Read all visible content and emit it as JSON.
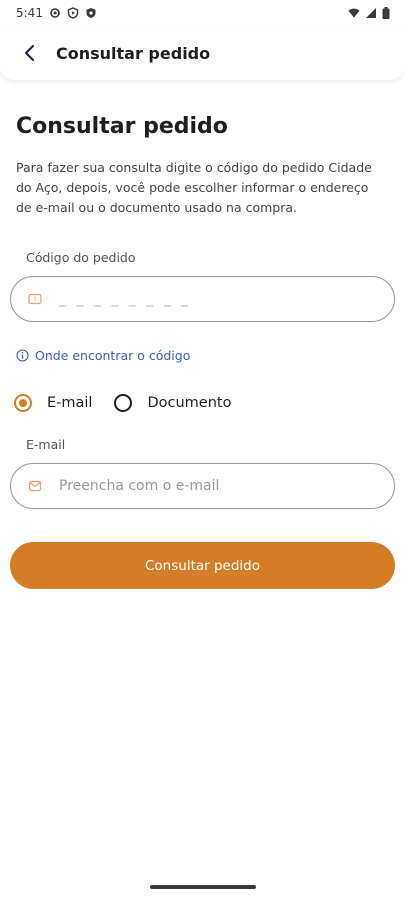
{
  "status_bar": {
    "time": "5:41",
    "icons": [
      "settings-icon",
      "shield-play-icon",
      "shield-icon",
      "wifi-icon",
      "signal-icon",
      "battery-icon"
    ]
  },
  "app_bar": {
    "back_icon": "chevron-left-icon",
    "title": "Consultar pedido"
  },
  "main": {
    "title": "Consultar pedido",
    "description": "Para fazer sua consulta digite o código do pedido Cidade do Aço, depois, você pode escolher informar o endereço de e-mail ou o documento usado na compra.",
    "code_field": {
      "label": "Código do pedido",
      "placeholder": "_ _ _ _ _ _ _ _",
      "value": "",
      "icon": "ticket-icon"
    },
    "help_link": {
      "icon": "info-icon",
      "text": "Onde encontrar o código"
    },
    "contact_type": {
      "options": [
        {
          "label": "E-mail",
          "selected": true
        },
        {
          "label": "Documento",
          "selected": false
        }
      ]
    },
    "email_field": {
      "label": "E-mail",
      "placeholder": "Preencha com o e-mail",
      "value": "",
      "icon": "mail-icon"
    },
    "submit_label": "Consultar pedido"
  },
  "colors": {
    "accent": "#d57c27",
    "link": "#3b5fb8",
    "text": "#1f1f1f"
  }
}
